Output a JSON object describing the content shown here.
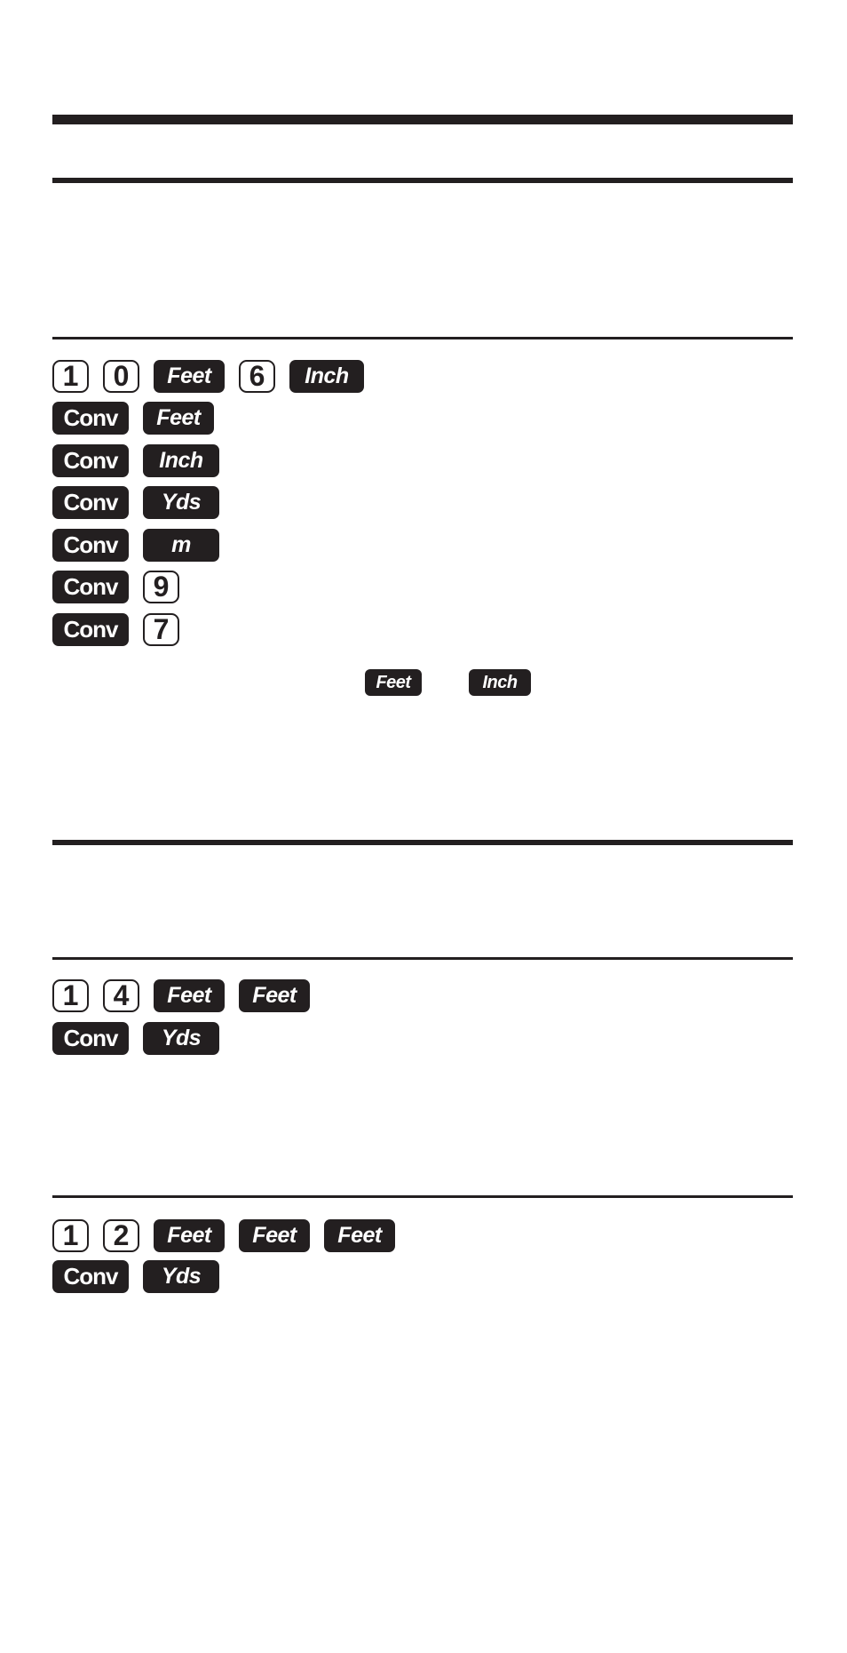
{
  "colors": {
    "ink": "#231f20",
    "paper": "#ffffff"
  },
  "example1": {
    "entry_keys": [
      "1",
      "0",
      "Feet",
      "6",
      "Inch"
    ],
    "conversions": [
      [
        "Conv",
        "Feet"
      ],
      [
        "Conv",
        "Inch"
      ],
      [
        "Conv",
        "Yds"
      ],
      [
        "Conv",
        "m"
      ],
      [
        "Conv",
        "9"
      ],
      [
        "Conv",
        "7"
      ]
    ],
    "inline_keys": [
      "Feet",
      "Inch"
    ]
  },
  "example2": {
    "entry_keys": [
      "1",
      "4",
      "Feet",
      "Feet"
    ],
    "conversion": [
      "Conv",
      "Yds"
    ]
  },
  "example3": {
    "entry_keys": [
      "1",
      "2",
      "Feet",
      "Feet",
      "Feet"
    ],
    "conversion": [
      "Conv",
      "Yds"
    ]
  }
}
